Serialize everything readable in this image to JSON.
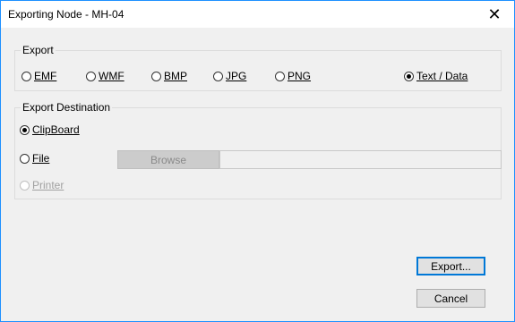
{
  "window": {
    "title": "Exporting Node - MH-04",
    "close_glyph": "✕"
  },
  "export_group": {
    "label": "Export",
    "options": [
      {
        "label": "EMF",
        "checked": false
      },
      {
        "label": "WMF",
        "checked": false
      },
      {
        "label": "BMP",
        "checked": false
      },
      {
        "label": "JPG",
        "checked": false
      },
      {
        "label": "PNG",
        "checked": false
      },
      {
        "label": "Text / Data",
        "checked": true
      }
    ]
  },
  "destination_group": {
    "label": "Export Destination",
    "options": [
      {
        "label": "ClipBoard",
        "checked": true,
        "enabled": true
      },
      {
        "label": "File",
        "checked": false,
        "enabled": true
      },
      {
        "label": "Printer",
        "checked": false,
        "enabled": false
      }
    ],
    "browse_label": "Browse",
    "file_path_value": ""
  },
  "buttons": {
    "export_label": "Export...",
    "cancel_label": "Cancel"
  }
}
